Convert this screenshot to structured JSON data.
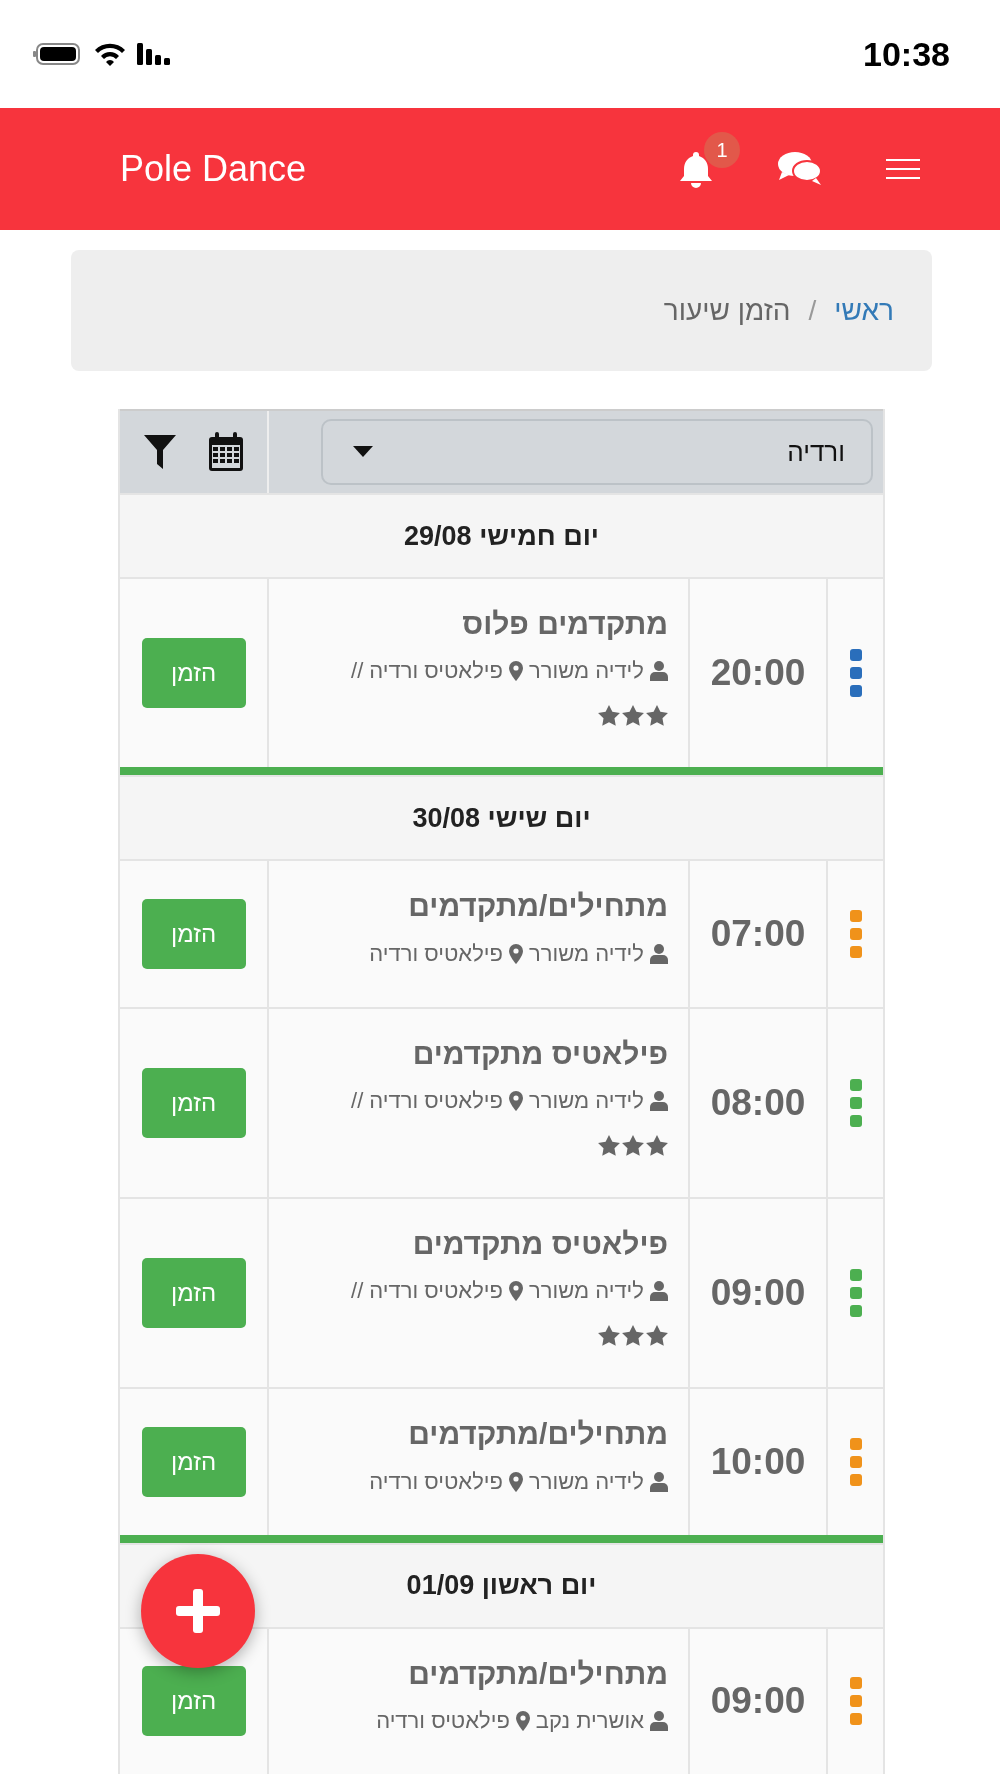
{
  "status_bar": {
    "time": "10:38"
  },
  "header": {
    "title": "Pole Dance",
    "notification_count": "1"
  },
  "breadcrumb": {
    "items": [
      {
        "label": "ראשי",
        "kind": "link"
      },
      {
        "label": "הזמן שיעור",
        "kind": "current"
      }
    ],
    "separator": "/"
  },
  "filter_bar": {
    "studio_select": {
      "value": "ורדיה"
    }
  },
  "days": [
    {
      "title": "יום חמישי 29/08",
      "classes": [
        {
          "time": "20:00",
          "color": "#2a6ebb",
          "name": "מתקדמים פלוס",
          "instructor": "לידיה משורר",
          "location": "פילאטיס ורדיה",
          "rating_separator": "//",
          "stars": 3,
          "button": "הזמן"
        }
      ]
    },
    {
      "title": "יום שישי 30/08",
      "classes": [
        {
          "time": "07:00",
          "color": "#f0921a",
          "name": "מתחילים/מתקדמים",
          "instructor": "לידיה משורר",
          "location": "פילאטיס ורדיה",
          "button": "הזמן"
        },
        {
          "time": "08:00",
          "color": "#4caf50",
          "name": "פילאטיס מתקדמים",
          "instructor": "לידיה משורר",
          "location": "פילאטיס ורדיה",
          "rating_separator": "//",
          "stars": 3,
          "button": "הזמן"
        },
        {
          "time": "09:00",
          "color": "#4caf50",
          "name": "פילאטיס מתקדמים",
          "instructor": "לידיה משורר",
          "location": "פילאטיס ורדיה",
          "rating_separator": "//",
          "stars": 3,
          "button": "הזמן"
        },
        {
          "time": "10:00",
          "color": "#f0921a",
          "name": "מתחילים/מתקדמים",
          "instructor": "לידיה משורר",
          "location": "פילאטיס ורדיה",
          "button": "הזמן"
        }
      ]
    },
    {
      "title": "יום ראשון 01/09",
      "classes": [
        {
          "time": "09:00",
          "color": "#f0921a",
          "name": "מתחילים/מתקדמים",
          "instructor": "אושרית נקב",
          "location": "פילאטיס ורדיה",
          "button": "הזמן"
        }
      ]
    }
  ]
}
